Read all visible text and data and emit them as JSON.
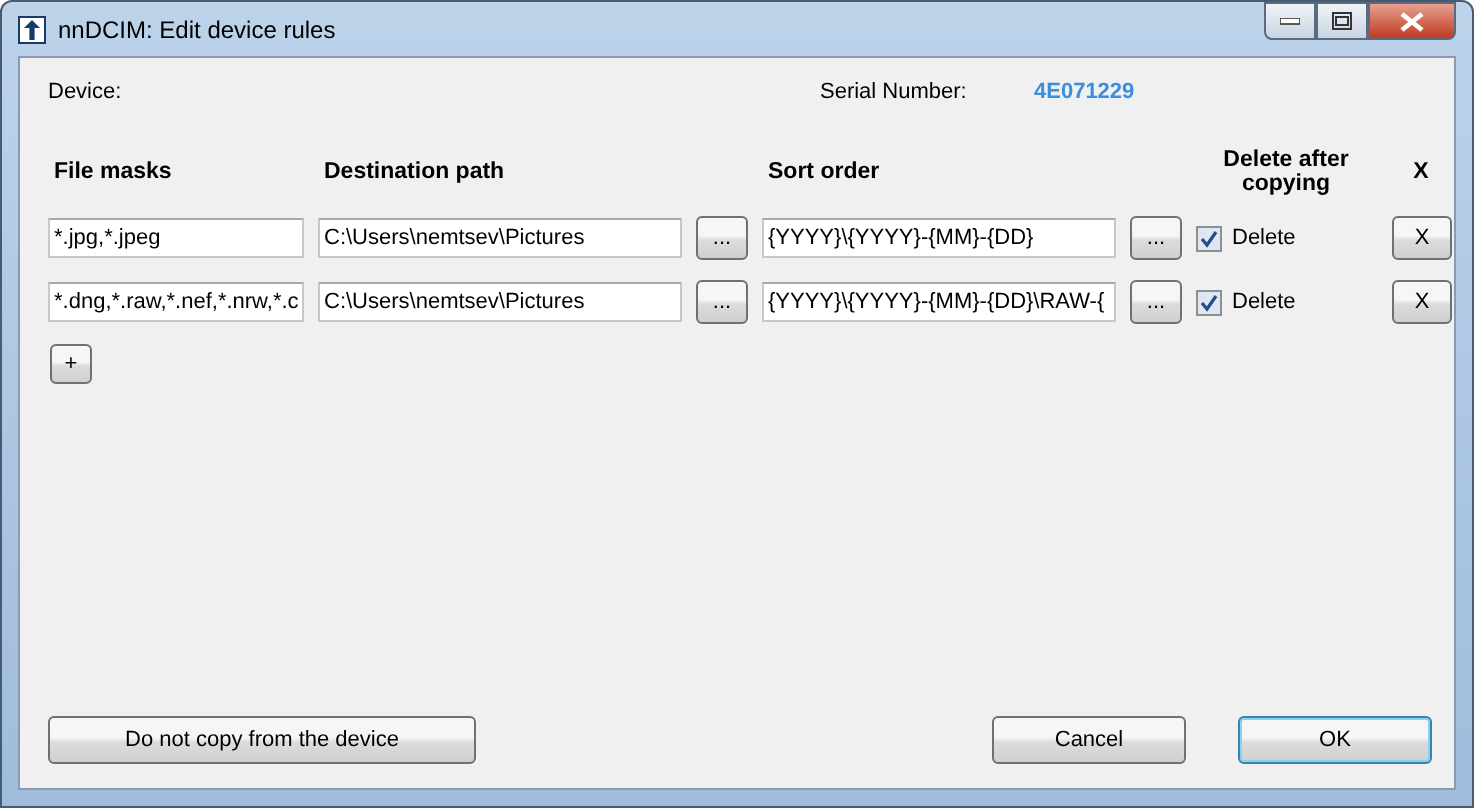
{
  "window": {
    "title": "nnDCIM: Edit device rules"
  },
  "device": {
    "label": "Device:",
    "serial_label": "Serial Number:",
    "serial_value": "4E071229"
  },
  "columns": [
    "File masks",
    "Destination path",
    "Sort order",
    "Delete after copying",
    "X"
  ],
  "rules": [
    {
      "masks": "*.jpg,*.jpeg",
      "path": "C:\\Users\\nemtsev\\Pictures",
      "path_button": "...",
      "sort": "{YYYY}\\{YYYY}-{MM}-{DD}",
      "sort_button": "...",
      "delete_label": "Delete",
      "delete_checked": true,
      "remove_button": "X"
    },
    {
      "masks": "*.dng,*.raw,*.nef,*.nrw,*.c",
      "path": "C:\\Users\\nemtsev\\Pictures",
      "path_button": "...",
      "sort": "{YYYY}\\{YYYY}-{MM}-{DD}\\RAW-{",
      "sort_button": "...",
      "delete_label": "Delete",
      "delete_checked": true,
      "remove_button": "X"
    }
  ],
  "add_button": "+",
  "buttons": {
    "skip": "Do not copy from the device",
    "cancel": "Cancel",
    "ok": "OK"
  }
}
